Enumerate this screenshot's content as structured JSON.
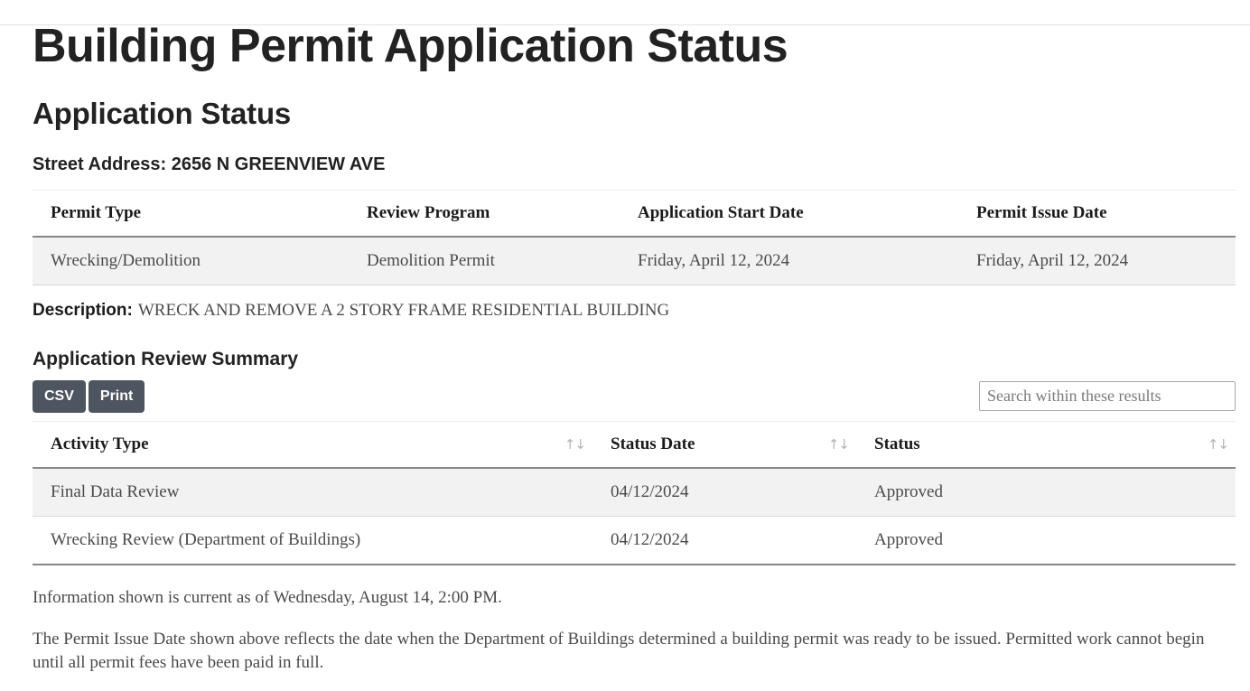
{
  "page": {
    "title": "Building Permit Application Status",
    "section_title": "Application Status",
    "street_address": "Street Address: 2656 N GREENVIEW AVE",
    "subsection_title": "Application Review Summary"
  },
  "permit_table": {
    "headers": [
      "Permit Type",
      "Review Program",
      "Application Start Date",
      "Permit Issue Date"
    ],
    "rows": [
      {
        "permit_type": "Wrecking/Demolition",
        "review_program": "Demolition Permit",
        "application_start_date": "Friday, April 12, 2024",
        "permit_issue_date": "Friday, April 12, 2024"
      }
    ]
  },
  "description": {
    "label": "Description:",
    "text": "WRECK AND REMOVE A 2 STORY FRAME RESIDENTIAL BUILDING"
  },
  "toolbar": {
    "csv_label": "CSV",
    "print_label": "Print",
    "search_placeholder": "Search within these results",
    "search_value": ""
  },
  "activity_table": {
    "headers": [
      "Activity Type",
      "Status Date",
      "Status"
    ],
    "sort_icon": "↑↓",
    "rows": [
      {
        "activity_type": "Final Data Review",
        "status_date": "04/12/2024",
        "status": "Approved"
      },
      {
        "activity_type": "Wrecking Review (Department of Buildings)",
        "status_date": "04/12/2024",
        "status": "Approved"
      }
    ]
  },
  "notes": {
    "currency_note": "Information shown is current as of Wednesday, August 14, 2:00 PM.",
    "issue_date_note": "The Permit Issue Date shown above reflects the date when the Department of Buildings determined a building permit was ready to be issued. Permitted work cannot begin until all permit fees have been paid in full."
  },
  "colors": {
    "button_bg": "#4d5560",
    "stripe_bg": "#f2f2f2",
    "rule": "#85878b",
    "text": "#4a4a4a",
    "heading": "#222222"
  }
}
